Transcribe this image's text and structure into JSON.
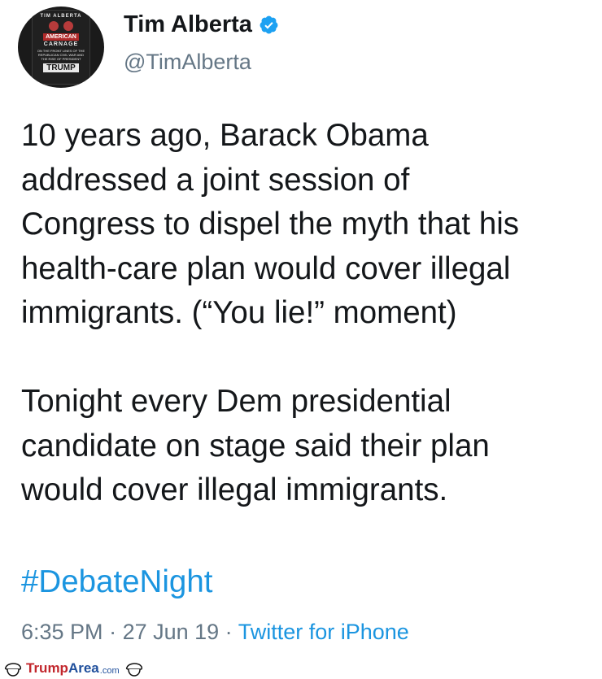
{
  "author": {
    "display_name": "Tim Alberta",
    "handle": "@TimAlberta",
    "verified": true,
    "avatar": {
      "book_author": "TIM ALBERTA",
      "book_title_1": "AMERICAN",
      "book_title_2": "CARNAGE",
      "book_subtitle": "ON THE FRONT LINES OF THE REPUBLICAN CIVIL WAR AND THE RISE OF PRESIDENT",
      "book_name": "TRUMP"
    }
  },
  "tweet": {
    "lines": [
      "10 years ago, Barack Obama",
      "addressed a joint session of",
      "Congress to dispel the myth that his",
      "health-care plan would cover illegal",
      "immigrants. (“You lie!” moment)",
      "",
      "Tonight every Dem presidential",
      "candidate on stage said their plan",
      "would cover illegal immigrants."
    ],
    "hashtag": "#DebateNight"
  },
  "meta": {
    "time": "6:35 PM",
    "sep1": " · ",
    "date": "27 Jun 19",
    "sep2": " · ",
    "source": "Twitter for iPhone"
  },
  "watermark": {
    "part1": "Trump",
    "part2": "Area",
    "part3": ".com"
  },
  "colors": {
    "link": "#1b95e0",
    "secondary_text": "#657786",
    "verified_badge": "#1da1f2",
    "watermark_red": "#c2272d",
    "watermark_blue": "#1f4f9c"
  },
  "icons": {
    "verified": "verified-badge-icon",
    "watermark_face": "trump-hair-icon"
  }
}
